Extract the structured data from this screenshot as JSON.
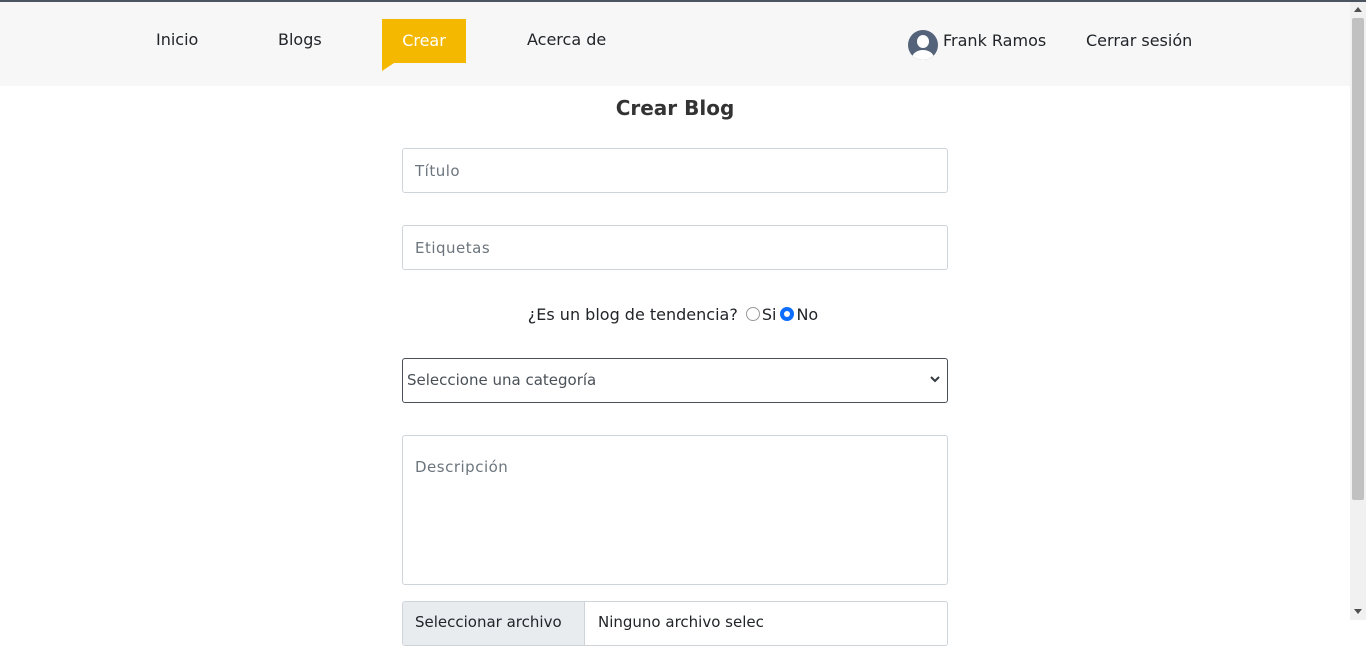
{
  "nav": {
    "items": [
      {
        "label": "Inicio"
      },
      {
        "label": "Blogs"
      },
      {
        "label": "Crear",
        "active": true
      },
      {
        "label": "Acerca de"
      }
    ],
    "active_color": "#f5b800",
    "user_name": "Frank Ramos",
    "avatar_icon": "user-avatar-icon",
    "logout_label": "Cerrar sesión"
  },
  "form": {
    "title": "Crear Blog",
    "titulo_placeholder": "Título",
    "etiquetas_placeholder": "Etiquetas",
    "trending_question": "¿Es un blog de tendencia?",
    "trending_options": [
      {
        "label": "Si",
        "checked": false
      },
      {
        "label": "No",
        "checked": true
      }
    ],
    "category_selected": "Seleccione una categoría",
    "descripcion_placeholder": "Descripción",
    "file_button_label": "Seleccionar archivo",
    "file_status": "Ninguno archivo selec"
  }
}
